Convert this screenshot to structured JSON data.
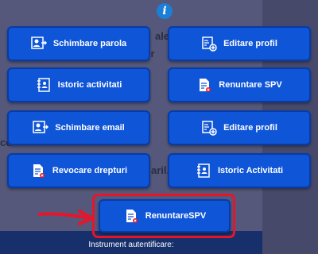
{
  "background": {
    "fragments": [
      "ale",
      "e Pr",
      "ce",
      "aril."
    ],
    "footer_label": "Instrument autentificare:"
  },
  "info_icon": "info-icon",
  "menu": {
    "buttons": [
      {
        "label": "Schimbare parola",
        "icon": "user-swap-icon"
      },
      {
        "label": "Editare profil",
        "icon": "certificate-add-icon"
      },
      {
        "label": "Istoric activitati",
        "icon": "history-user-icon"
      },
      {
        "label": "Renuntare SPV",
        "icon": "document-remove-icon"
      },
      {
        "label": "Schimbare email",
        "icon": "user-swap-icon"
      },
      {
        "label": "Editare profil",
        "icon": "certificate-add-icon"
      },
      {
        "label": "Revocare drepturi",
        "icon": "document-remove-icon"
      },
      {
        "label": "Istoric Activitati",
        "icon": "history-user-icon"
      }
    ],
    "highlighted": {
      "label": "RenuntareSPV",
      "icon": "document-remove-icon"
    }
  },
  "colors": {
    "button": "#0f55d8",
    "highlight": "#e8142a"
  }
}
